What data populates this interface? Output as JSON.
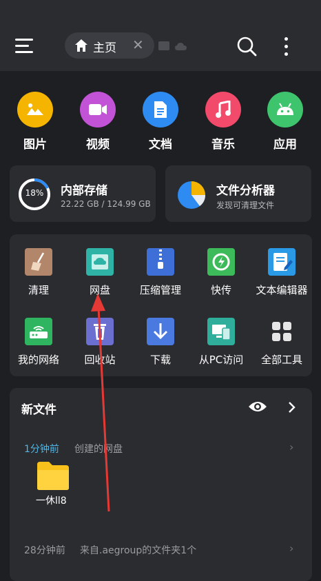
{
  "topbar": {
    "tab_label": "主页",
    "icons": [
      "menu-icon",
      "home-icon",
      "close-icon",
      "sd-card-icon",
      "cloud-icon",
      "search-icon",
      "more-vert-icon"
    ]
  },
  "categories": [
    {
      "label": "图片",
      "color": "#f5b400",
      "icon": "image-icon"
    },
    {
      "label": "视频",
      "color": "#c353d6",
      "icon": "video-icon"
    },
    {
      "label": "文档",
      "color": "#2e8bf2",
      "icon": "document-icon"
    },
    {
      "label": "音乐",
      "color": "#f14a6b",
      "icon": "music-icon"
    },
    {
      "label": "应用",
      "color": "#3ec46d",
      "icon": "android-icon"
    }
  ],
  "storage": {
    "title": "内部存储",
    "usage": "22.22 GB / 124.99 GB",
    "percent_label": "18%",
    "percent": 0.18,
    "ring_color": "#2e8bf2"
  },
  "analyzer": {
    "title": "文件分析器",
    "subtitle": "发现可清理文件"
  },
  "tools": [
    {
      "label": "清理",
      "icon": "broom-icon",
      "color": "#b2866a"
    },
    {
      "label": "网盘",
      "icon": "cloud-drive-icon",
      "color": "#2fb3a6"
    },
    {
      "label": "压缩管理",
      "icon": "zip-icon",
      "color": "#3d6fd6"
    },
    {
      "label": "快传",
      "icon": "transfer-icon",
      "color": "#3dbb5a"
    },
    {
      "label": "文本编辑器",
      "icon": "text-editor-icon",
      "color": "#2a9ae6"
    },
    {
      "label": "我的网络",
      "icon": "network-icon",
      "color": "#2fb560"
    },
    {
      "label": "回收站",
      "icon": "trash-icon",
      "color": "#6b6fd0"
    },
    {
      "label": "下载",
      "icon": "download-icon",
      "color": "#4a7ae0"
    },
    {
      "label": "从PC访问",
      "icon": "pc-access-icon",
      "color": "#2fae9c"
    },
    {
      "label": "全部工具",
      "icon": "grid-icon",
      "color": "#e6e6e6"
    }
  ],
  "new_files": {
    "title": "新文件",
    "entries": [
      {
        "time": "1分钟前",
        "desc": "创建的网盘",
        "folder_name": "一休ll8"
      },
      {
        "time": "28分钟前",
        "desc": "来自.aegroup的文件夹1个"
      }
    ]
  },
  "colors": {
    "background": "#1e1f22",
    "card": "#2b2c30",
    "accent_time": "#4fb7e8",
    "annotation_arrow": "#e53935"
  }
}
